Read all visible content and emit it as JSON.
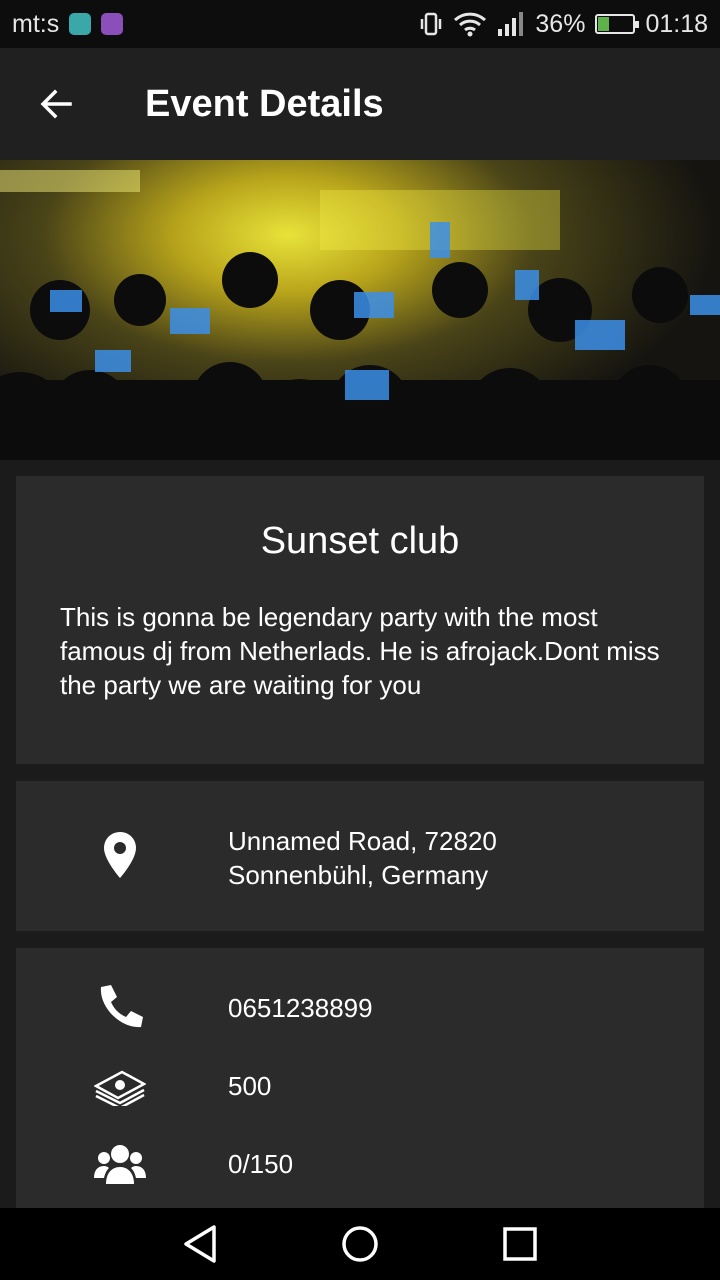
{
  "status_bar": {
    "carrier": "mt:s",
    "battery_percent": "36%",
    "battery_level": 0.36,
    "time": "01:18"
  },
  "app_bar": {
    "title": "Event Details",
    "back_icon": "arrow-back-icon"
  },
  "hero": {
    "image": "concert-crowd-photo"
  },
  "event": {
    "name": "Sunset club",
    "description": "This is gonna be legendary party with the most famous dj from Netherlads. He is afrojack.Dont miss the party we are waiting for you"
  },
  "location": {
    "icon": "location-pin-icon",
    "line1": "Unnamed Road, 72820",
    "line2": "Sonnenbühl, Germany"
  },
  "details": [
    {
      "icon": "phone-icon",
      "value": "0651238899"
    },
    {
      "icon": "money-icon",
      "value": "500"
    },
    {
      "icon": "people-icon",
      "value": "0/150"
    }
  ],
  "nav_bar": {
    "back": "nav-back-icon",
    "home": "nav-home-icon",
    "recents": "nav-recents-icon"
  },
  "colors": {
    "background": "#1b1b1b",
    "card": "#2b2b2b",
    "appbar": "#202020",
    "battery": "#5fb14b"
  }
}
